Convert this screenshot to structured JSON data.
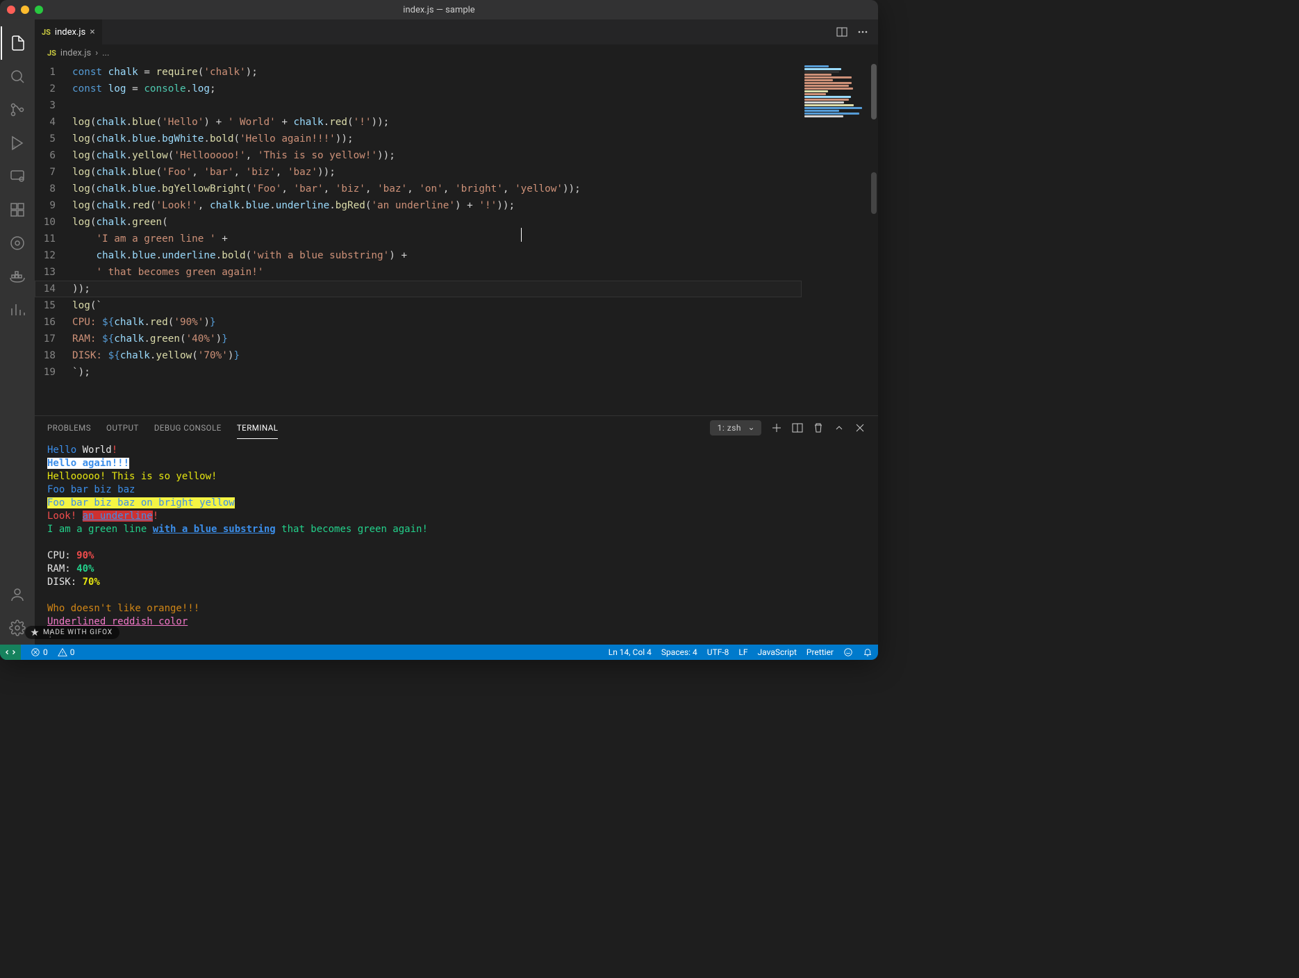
{
  "window": {
    "title": "index.js — sample"
  },
  "tab": {
    "badge": "JS",
    "filename": "index.js"
  },
  "breadcrumb": {
    "badge": "JS",
    "file": "index.js",
    "sep": "›",
    "ellipsis": "..."
  },
  "code_lines": [
    {
      "n": "1",
      "tokens": [
        [
          "c-kw",
          "const "
        ],
        [
          "c-var",
          "chalk"
        ],
        [
          "c-op",
          " = "
        ],
        [
          "c-fn",
          "require"
        ],
        [
          "c-punc",
          "("
        ],
        [
          "c-str",
          "'chalk'"
        ],
        [
          "c-punc",
          ");"
        ]
      ]
    },
    {
      "n": "2",
      "tokens": [
        [
          "c-kw",
          "const "
        ],
        [
          "c-var",
          "log"
        ],
        [
          "c-op",
          " = "
        ],
        [
          "c-obj",
          "console"
        ],
        [
          "c-punc",
          "."
        ],
        [
          "c-var",
          "log"
        ],
        [
          "c-punc",
          ";"
        ]
      ]
    },
    {
      "n": "3",
      "tokens": [
        [
          "c-punc",
          ""
        ]
      ]
    },
    {
      "n": "4",
      "tokens": [
        [
          "c-fn",
          "log"
        ],
        [
          "c-punc",
          "("
        ],
        [
          "c-var",
          "chalk"
        ],
        [
          "c-punc",
          "."
        ],
        [
          "c-fn",
          "blue"
        ],
        [
          "c-punc",
          "("
        ],
        [
          "c-str",
          "'Hello'"
        ],
        [
          "c-punc",
          ") + "
        ],
        [
          "c-str",
          "' World'"
        ],
        [
          "c-punc",
          " + "
        ],
        [
          "c-var",
          "chalk"
        ],
        [
          "c-punc",
          "."
        ],
        [
          "c-fn",
          "red"
        ],
        [
          "c-punc",
          "("
        ],
        [
          "c-str",
          "'!'"
        ],
        [
          "c-punc",
          "));"
        ]
      ]
    },
    {
      "n": "5",
      "tokens": [
        [
          "c-fn",
          "log"
        ],
        [
          "c-punc",
          "("
        ],
        [
          "c-var",
          "chalk"
        ],
        [
          "c-punc",
          "."
        ],
        [
          "c-var",
          "blue"
        ],
        [
          "c-punc",
          "."
        ],
        [
          "c-var",
          "bgWhite"
        ],
        [
          "c-punc",
          "."
        ],
        [
          "c-fn",
          "bold"
        ],
        [
          "c-punc",
          "("
        ],
        [
          "c-str",
          "'Hello again!!!'"
        ],
        [
          "c-punc",
          "));"
        ]
      ]
    },
    {
      "n": "6",
      "tokens": [
        [
          "c-fn",
          "log"
        ],
        [
          "c-punc",
          "("
        ],
        [
          "c-var",
          "chalk"
        ],
        [
          "c-punc",
          "."
        ],
        [
          "c-fn",
          "yellow"
        ],
        [
          "c-punc",
          "("
        ],
        [
          "c-str",
          "'Hellooooo!'"
        ],
        [
          "c-punc",
          ", "
        ],
        [
          "c-str",
          "'This is so yellow!'"
        ],
        [
          "c-punc",
          "));"
        ]
      ]
    },
    {
      "n": "7",
      "tokens": [
        [
          "c-fn",
          "log"
        ],
        [
          "c-punc",
          "("
        ],
        [
          "c-var",
          "chalk"
        ],
        [
          "c-punc",
          "."
        ],
        [
          "c-fn",
          "blue"
        ],
        [
          "c-punc",
          "("
        ],
        [
          "c-str",
          "'Foo'"
        ],
        [
          "c-punc",
          ", "
        ],
        [
          "c-str",
          "'bar'"
        ],
        [
          "c-punc",
          ", "
        ],
        [
          "c-str",
          "'biz'"
        ],
        [
          "c-punc",
          ", "
        ],
        [
          "c-str",
          "'baz'"
        ],
        [
          "c-punc",
          "));"
        ]
      ]
    },
    {
      "n": "8",
      "tokens": [
        [
          "c-fn",
          "log"
        ],
        [
          "c-punc",
          "("
        ],
        [
          "c-var",
          "chalk"
        ],
        [
          "c-punc",
          "."
        ],
        [
          "c-var",
          "blue"
        ],
        [
          "c-punc",
          "."
        ],
        [
          "c-fn",
          "bgYellowBright"
        ],
        [
          "c-punc",
          "("
        ],
        [
          "c-str",
          "'Foo'"
        ],
        [
          "c-punc",
          ", "
        ],
        [
          "c-str",
          "'bar'"
        ],
        [
          "c-punc",
          ", "
        ],
        [
          "c-str",
          "'biz'"
        ],
        [
          "c-punc",
          ", "
        ],
        [
          "c-str",
          "'baz'"
        ],
        [
          "c-punc",
          ", "
        ],
        [
          "c-str",
          "'on'"
        ],
        [
          "c-punc",
          ", "
        ],
        [
          "c-str",
          "'bright'"
        ],
        [
          "c-punc",
          ", "
        ],
        [
          "c-str",
          "'yellow'"
        ],
        [
          "c-punc",
          "));"
        ]
      ]
    },
    {
      "n": "9",
      "tokens": [
        [
          "c-fn",
          "log"
        ],
        [
          "c-punc",
          "("
        ],
        [
          "c-var",
          "chalk"
        ],
        [
          "c-punc",
          "."
        ],
        [
          "c-fn",
          "red"
        ],
        [
          "c-punc",
          "("
        ],
        [
          "c-str",
          "'Look!'"
        ],
        [
          "c-punc",
          ", "
        ],
        [
          "c-var",
          "chalk"
        ],
        [
          "c-punc",
          "."
        ],
        [
          "c-var",
          "blue"
        ],
        [
          "c-punc",
          "."
        ],
        [
          "c-var",
          "underline"
        ],
        [
          "c-punc",
          "."
        ],
        [
          "c-fn",
          "bgRed"
        ],
        [
          "c-punc",
          "("
        ],
        [
          "c-str",
          "'an underline'"
        ],
        [
          "c-punc",
          ") + "
        ],
        [
          "c-str",
          "'!'"
        ],
        [
          "c-punc",
          "));"
        ]
      ]
    },
    {
      "n": "10",
      "tokens": [
        [
          "c-fn",
          "log"
        ],
        [
          "c-punc",
          "("
        ],
        [
          "c-var",
          "chalk"
        ],
        [
          "c-punc",
          "."
        ],
        [
          "c-fn",
          "green"
        ],
        [
          "c-punc",
          "("
        ]
      ]
    },
    {
      "n": "11",
      "tokens": [
        [
          "c-punc",
          "    "
        ],
        [
          "c-str",
          "'I am a green line '"
        ],
        [
          "c-punc",
          " +"
        ]
      ]
    },
    {
      "n": "12",
      "tokens": [
        [
          "c-punc",
          "    "
        ],
        [
          "c-var",
          "chalk"
        ],
        [
          "c-punc",
          "."
        ],
        [
          "c-var",
          "blue"
        ],
        [
          "c-punc",
          "."
        ],
        [
          "c-var",
          "underline"
        ],
        [
          "c-punc",
          "."
        ],
        [
          "c-fn",
          "bold"
        ],
        [
          "c-punc",
          "("
        ],
        [
          "c-str",
          "'with a blue substring'"
        ],
        [
          "c-punc",
          ") +"
        ]
      ]
    },
    {
      "n": "13",
      "tokens": [
        [
          "c-punc",
          "    "
        ],
        [
          "c-str",
          "' that becomes green again!'"
        ]
      ]
    },
    {
      "n": "14",
      "tokens": [
        [
          "c-punc",
          "));"
        ]
      ],
      "active": true
    },
    {
      "n": "15",
      "tokens": [
        [
          "c-fn",
          "log"
        ],
        [
          "c-punc",
          "(`"
        ]
      ]
    },
    {
      "n": "16",
      "tokens": [
        [
          "c-str",
          "CPU: "
        ],
        [
          "c-tpl",
          "${"
        ],
        [
          "c-var",
          "chalk"
        ],
        [
          "c-punc",
          "."
        ],
        [
          "c-fn",
          "red"
        ],
        [
          "c-punc",
          "("
        ],
        [
          "c-str",
          "'90%'"
        ],
        [
          "c-punc",
          ")"
        ],
        [
          "c-tpl",
          "}"
        ]
      ]
    },
    {
      "n": "17",
      "tokens": [
        [
          "c-str",
          "RAM: "
        ],
        [
          "c-tpl",
          "${"
        ],
        [
          "c-var",
          "chalk"
        ],
        [
          "c-punc",
          "."
        ],
        [
          "c-fn",
          "green"
        ],
        [
          "c-punc",
          "("
        ],
        [
          "c-str",
          "'40%'"
        ],
        [
          "c-punc",
          ")"
        ],
        [
          "c-tpl",
          "}"
        ]
      ]
    },
    {
      "n": "18",
      "tokens": [
        [
          "c-str",
          "DISK: "
        ],
        [
          "c-tpl",
          "${"
        ],
        [
          "c-var",
          "chalk"
        ],
        [
          "c-punc",
          "."
        ],
        [
          "c-fn",
          "yellow"
        ],
        [
          "c-punc",
          "("
        ],
        [
          "c-str",
          "'70%'"
        ],
        [
          "c-punc",
          ")"
        ],
        [
          "c-tpl",
          "}"
        ]
      ]
    },
    {
      "n": "19",
      "tokens": [
        [
          "c-punc",
          "`);"
        ]
      ]
    }
  ],
  "panel": {
    "tabs": [
      "PROBLEMS",
      "OUTPUT",
      "DEBUG CONSOLE",
      "TERMINAL"
    ],
    "active_tab": "TERMINAL",
    "term_select": "1: zsh"
  },
  "terminal_lines": [
    [
      [
        "t-blue",
        "Hello"
      ],
      [
        "t-white",
        " World"
      ],
      [
        "t-red",
        "!"
      ]
    ],
    [
      [
        "bg-white",
        "Hello again!!!"
      ]
    ],
    [
      [
        "t-yellow",
        "Hellooooo! This is so yellow!"
      ]
    ],
    [
      [
        "t-blue",
        "Foo bar biz baz"
      ]
    ],
    [
      [
        "bg-yellowb",
        "Foo bar biz baz on bright yellow"
      ]
    ],
    [
      [
        "t-red",
        "Look! "
      ],
      [
        "bg-red",
        "an underline"
      ],
      [
        "t-red",
        "!"
      ]
    ],
    [
      [
        "t-green",
        "I am a green line "
      ],
      [
        "t-blue bold under",
        "with a blue substring"
      ],
      [
        "t-green",
        " that becomes green again!"
      ]
    ],
    [
      [
        "",
        ""
      ]
    ],
    [
      [
        "t-white",
        "CPU: "
      ],
      [
        "t-red bold",
        "90%"
      ]
    ],
    [
      [
        "t-white",
        "RAM: "
      ],
      [
        "t-green bold",
        "40%"
      ]
    ],
    [
      [
        "t-white",
        "DISK: "
      ],
      [
        "t-yellow bold",
        "70%"
      ]
    ],
    [
      [
        "",
        ""
      ]
    ],
    [
      [
        "t-orange",
        "Who doesn't like orange!!!"
      ]
    ],
    [
      [
        "t-pink",
        "Underlined reddish color"
      ]
    ],
    [
      [
        "t-white",
        "!"
      ]
    ]
  ],
  "status": {
    "errors": "0",
    "warnings": "0",
    "cursor": "Ln 14, Col 4",
    "spaces": "Spaces: 4",
    "encoding": "UTF-8",
    "eol": "LF",
    "lang": "JavaScript",
    "formatter": "Prettier"
  },
  "watermark": "MADE WITH GIFOX"
}
